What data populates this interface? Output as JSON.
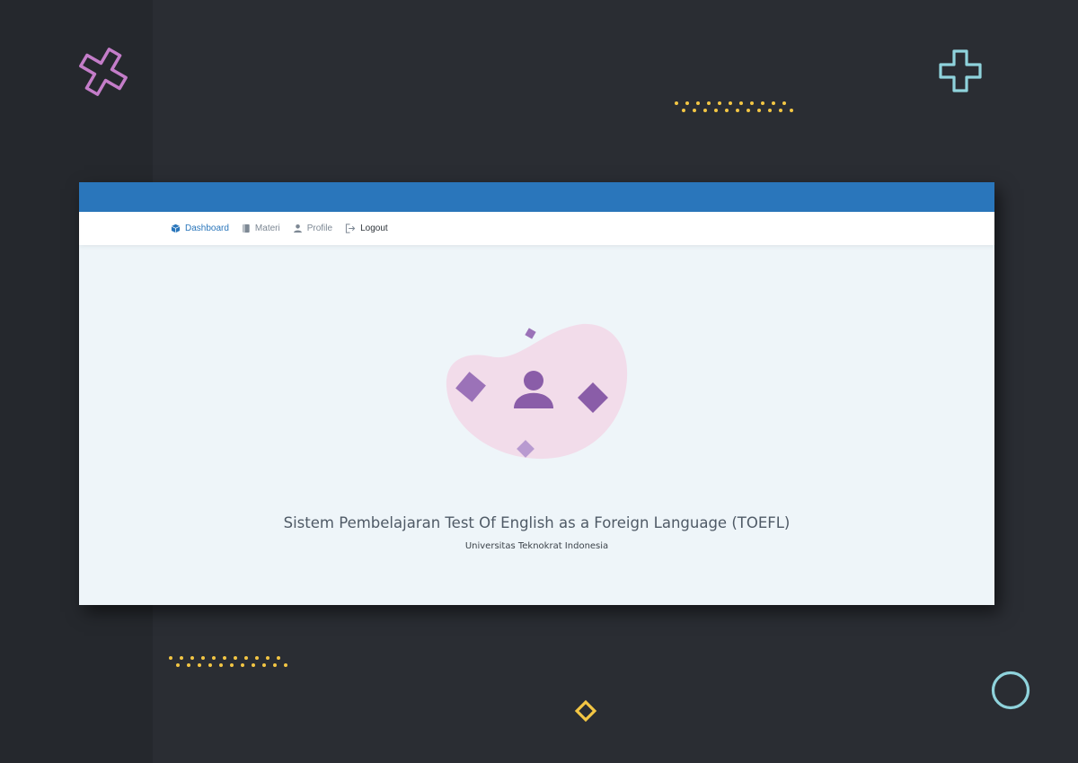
{
  "nav": {
    "items": [
      {
        "label": "Dashboard",
        "icon": "cube-icon",
        "active": true
      },
      {
        "label": "Materi",
        "icon": "book-icon"
      },
      {
        "label": "Profile",
        "icon": "user-icon"
      },
      {
        "label": "Logout",
        "icon": "logout-icon"
      }
    ]
  },
  "main": {
    "title": "Sistem Pembelajaran Test Of English as a Foreign Language (TOEFL)",
    "subtitle": "Universitas Teknokrat Indonesia"
  },
  "colors": {
    "topbar": "#2a76bb",
    "accent": "#2a76bb",
    "background": "#2a2d33",
    "content": "#eef5f9",
    "blob": "#f2dcea",
    "figure": "#8a5da8",
    "dots": "#f3c644",
    "pink_cross": "#c47dc9",
    "teal": "#8fd3dc"
  }
}
